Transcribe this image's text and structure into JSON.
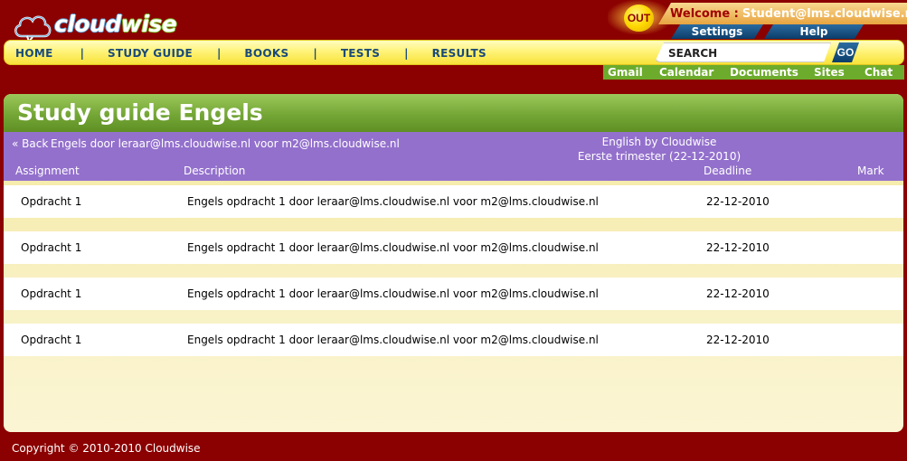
{
  "logo": {
    "part1": "cloud",
    "part2": "wise"
  },
  "header": {
    "out_label": "OUT",
    "welcome_label": "Welcome :",
    "user_email": "Student@lms.cloudwise.nl",
    "settings_label": "Settings",
    "help_label": "Help"
  },
  "nav": {
    "items": [
      "HOME",
      "STUDY GUIDE",
      "BOOKS",
      "TESTS",
      "RESULTS"
    ],
    "separator": "|"
  },
  "search": {
    "placeholder": "SEARCH",
    "go_label": "GO"
  },
  "apps": [
    "Gmail",
    "Calendar",
    "Documents",
    "Sites",
    "Chat"
  ],
  "page": {
    "title": "Study guide Engels",
    "back_label": "« Back",
    "course_line": "Engels door leraar@lms.cloudwise.nl voor m2@lms.cloudwise.nl",
    "course_name": "English by Cloudwise",
    "term": "Eerste trimester (22-12-2010)"
  },
  "table": {
    "columns": [
      "Assignment",
      "Description",
      "Deadline",
      "Mark"
    ],
    "rows": [
      {
        "assignment": "Opdracht 1",
        "description": "Engels opdracht 1 door leraar@lms.cloudwise.nl voor m2@lms.cloudwise.nl",
        "deadline": "22-12-2010",
        "mark": ""
      },
      {
        "assignment": "Opdracht 1",
        "description": "Engels opdracht 1 door leraar@lms.cloudwise.nl voor m2@lms.cloudwise.nl",
        "deadline": "22-12-2010",
        "mark": ""
      },
      {
        "assignment": "Opdracht 1",
        "description": "Engels opdracht 1 door leraar@lms.cloudwise.nl voor m2@lms.cloudwise.nl",
        "deadline": "22-12-2010",
        "mark": ""
      },
      {
        "assignment": "Opdracht 1",
        "description": "Engels opdracht 1 door leraar@lms.cloudwise.nl voor m2@lms.cloudwise.nl",
        "deadline": "22-12-2010",
        "mark": ""
      }
    ]
  },
  "footer": {
    "copyright": "Copyright © 2010-2010 Cloudwise"
  },
  "colors": {
    "background": "#8b0000",
    "nav_text": "#1a4a7a",
    "title_green": "#74a636",
    "info_purple": "#9370cc",
    "apps_green": "#6cab2c"
  }
}
